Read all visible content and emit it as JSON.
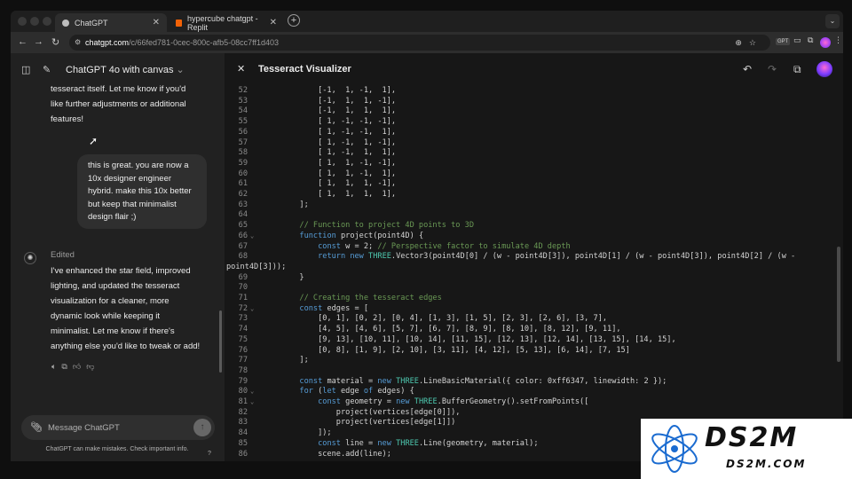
{
  "browser": {
    "tabs": [
      {
        "label": "ChatGPT",
        "active": true
      },
      {
        "label": "hypercube chatgpt - Replit",
        "active": false
      }
    ],
    "url_host": "chatgpt.com",
    "url_path": "/c/66fed781-0cec-800c-afb5-08cc7ff1d403",
    "profile_badge": "GPT"
  },
  "chat": {
    "title": "ChatGPT 4o with canvas",
    "assistant_prev": [
      "tesseract itself. Let me know if you'd",
      "like further adjustments or additional",
      "features!"
    ],
    "user_message": [
      "this is great. you are now a",
      "10x designer engineer",
      "hybrid. make this 10x better",
      "but keep that minimalist",
      "design flair ;)"
    ],
    "edited_label": "Edited",
    "assistant_reply": [
      "I've enhanced the star field, improved",
      "lighting, and updated the tesseract",
      "visualization for a cleaner, more",
      "dynamic look while keeping it",
      "minimalist. Let me know if there's",
      "anything else you'd like to tweak or add!"
    ],
    "composer_placeholder": "Message ChatGPT",
    "disclaimer": "ChatGPT can make mistakes. Check important info.",
    "help": "?"
  },
  "canvas": {
    "title": "Tesseract Visualizer",
    "lines": [
      {
        "n": "52",
        "fold": "",
        "t": "            [-1,  1, -1,  1],",
        "k": "plain"
      },
      {
        "n": "53",
        "fold": "",
        "t": "            [-1,  1,  1, -1],",
        "k": "plain"
      },
      {
        "n": "54",
        "fold": "",
        "t": "            [-1,  1,  1,  1],",
        "k": "plain"
      },
      {
        "n": "55",
        "fold": "",
        "t": "            [ 1, -1, -1, -1],",
        "k": "plain"
      },
      {
        "n": "56",
        "fold": "",
        "t": "            [ 1, -1, -1,  1],",
        "k": "plain"
      },
      {
        "n": "57",
        "fold": "",
        "t": "            [ 1, -1,  1, -1],",
        "k": "plain"
      },
      {
        "n": "58",
        "fold": "",
        "t": "            [ 1, -1,  1,  1],",
        "k": "plain"
      },
      {
        "n": "59",
        "fold": "",
        "t": "            [ 1,  1, -1, -1],",
        "k": "plain"
      },
      {
        "n": "60",
        "fold": "",
        "t": "            [ 1,  1, -1,  1],",
        "k": "plain"
      },
      {
        "n": "61",
        "fold": "",
        "t": "            [ 1,  1,  1, -1],",
        "k": "plain"
      },
      {
        "n": "62",
        "fold": "",
        "t": "            [ 1,  1,  1,  1],",
        "k": "plain"
      },
      {
        "n": "63",
        "fold": "",
        "t": "        ];",
        "k": "plain"
      },
      {
        "n": "64",
        "fold": "",
        "t": "",
        "k": "plain"
      },
      {
        "n": "65",
        "fold": "",
        "t": "        // Function to project 4D points to 3D",
        "k": "comment"
      },
      {
        "n": "66",
        "fold": "⌄",
        "t": "        function project(point4D) {",
        "k": "func"
      },
      {
        "n": "67",
        "fold": "",
        "t": "            const w = 2; // Perspective factor to simulate 4D depth",
        "k": "constw"
      },
      {
        "n": "68",
        "fold": "",
        "t": "            return new THREE.Vector3(point4D[0] / (w - point4D[3]), point4D[1] / (w - point4D[3]), point4D[2] / (w -",
        "k": "ret"
      },
      {
        "n": "",
        "fold": "",
        "t": "point4D[3]));",
        "k": "wrap"
      },
      {
        "n": "69",
        "fold": "",
        "t": "        }",
        "k": "plain"
      },
      {
        "n": "70",
        "fold": "",
        "t": "",
        "k": "plain"
      },
      {
        "n": "71",
        "fold": "",
        "t": "        // Creating the tesseract edges",
        "k": "comment"
      },
      {
        "n": "72",
        "fold": "⌄",
        "t": "        const edges = [",
        "k": "constdecl"
      },
      {
        "n": "73",
        "fold": "",
        "t": "            [0, 1], [0, 2], [0, 4], [1, 3], [1, 5], [2, 3], [2, 6], [3, 7],",
        "k": "plain"
      },
      {
        "n": "74",
        "fold": "",
        "t": "            [4, 5], [4, 6], [5, 7], [6, 7], [8, 9], [8, 10], [8, 12], [9, 11],",
        "k": "plain"
      },
      {
        "n": "75",
        "fold": "",
        "t": "            [9, 13], [10, 11], [10, 14], [11, 15], [12, 13], [12, 14], [13, 15], [14, 15],",
        "k": "plain"
      },
      {
        "n": "76",
        "fold": "",
        "t": "            [0, 8], [1, 9], [2, 10], [3, 11], [4, 12], [5, 13], [6, 14], [7, 15]",
        "k": "plain"
      },
      {
        "n": "77",
        "fold": "",
        "t": "        ];",
        "k": "plain"
      },
      {
        "n": "78",
        "fold": "",
        "t": "",
        "k": "plain"
      },
      {
        "n": "79",
        "fold": "",
        "t": "        const material = new THREE.LineBasicMaterial({ color: 0xff6347, linewidth: 2 });",
        "k": "material"
      },
      {
        "n": "80",
        "fold": "⌄",
        "t": "        for (let edge of edges) {",
        "k": "for"
      },
      {
        "n": "81",
        "fold": "⌄",
        "t": "            const geometry = new THREE.BufferGeometry().setFromPoints([",
        "k": "geometry"
      },
      {
        "n": "82",
        "fold": "",
        "t": "                project(vertices[edge[0]]),",
        "k": "plain"
      },
      {
        "n": "83",
        "fold": "",
        "t": "                project(vertices[edge[1]])",
        "k": "plain"
      },
      {
        "n": "84",
        "fold": "",
        "t": "            ]);",
        "k": "plain"
      },
      {
        "n": "85",
        "fold": "",
        "t": "            const line = new THREE.Line(geometry, material);",
        "k": "lineobj"
      },
      {
        "n": "86",
        "fold": "",
        "t": "            scene.add(line);",
        "k": "plain"
      }
    ]
  },
  "watermark": {
    "big": "DS2M",
    "small": "DS2M.COM"
  },
  "colors": {
    "keyword": "#569cd6",
    "comment": "#6a9955",
    "class": "#4ec9b0",
    "text": "#d4d4d4"
  }
}
